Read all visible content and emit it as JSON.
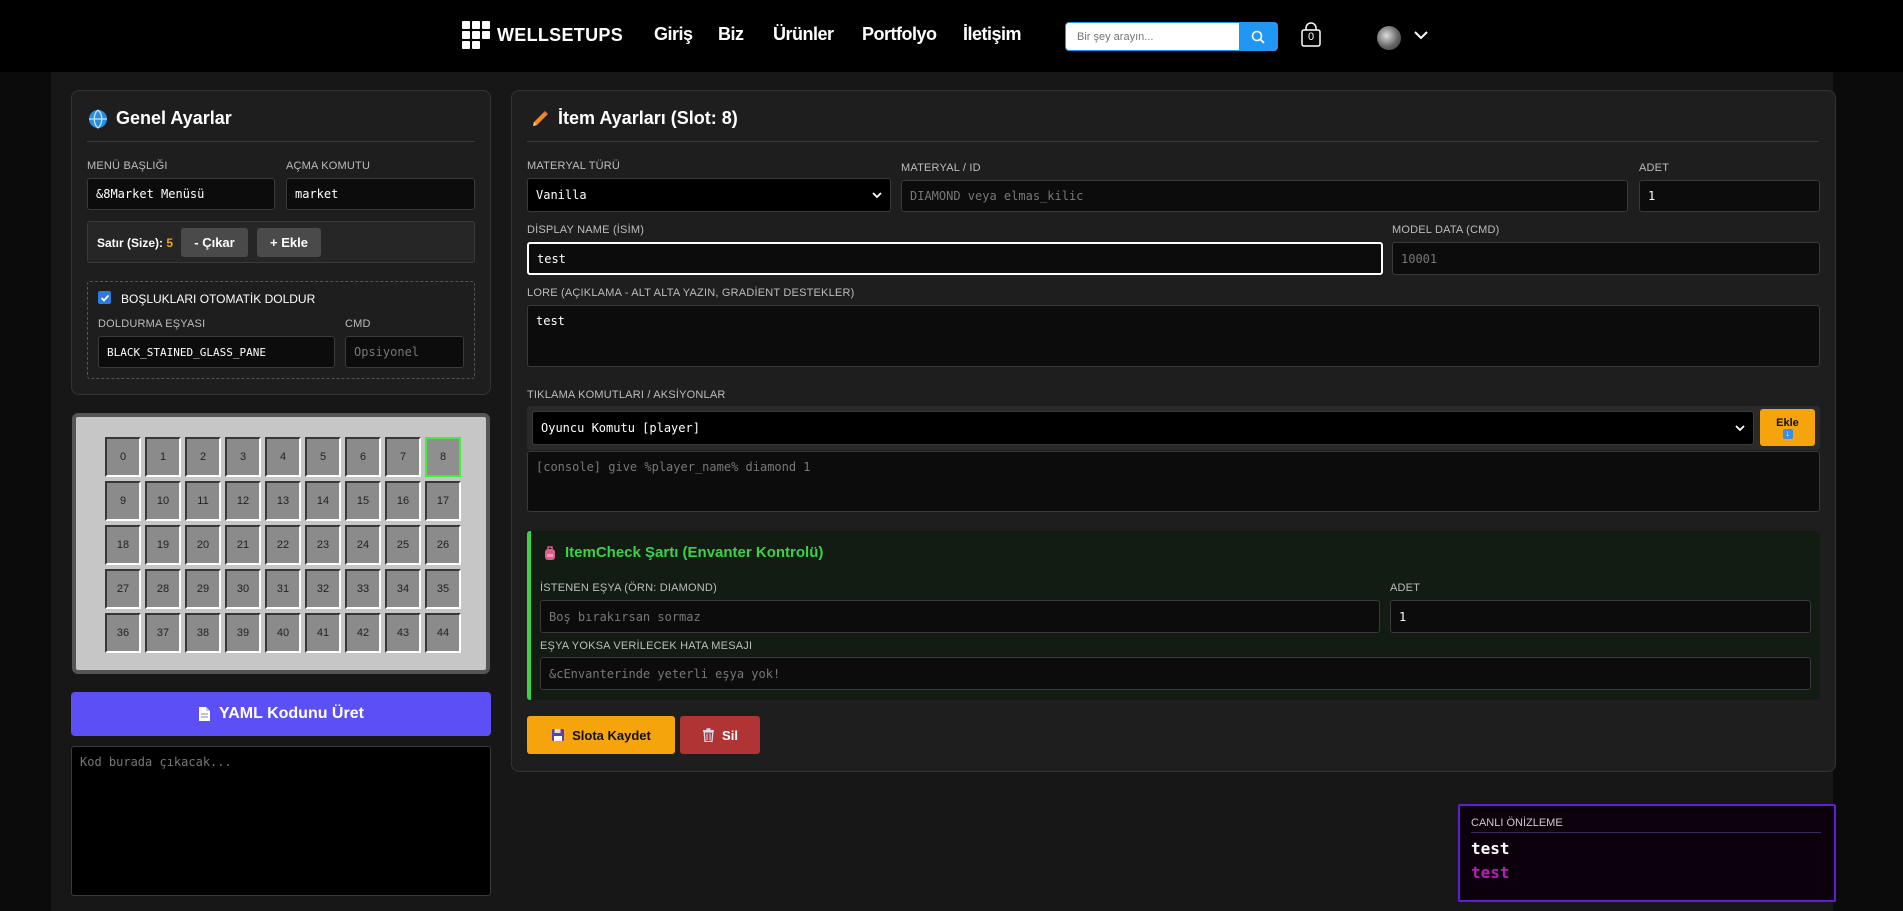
{
  "navbar": {
    "brand": "WELLSETUPS",
    "links": [
      "Giriş",
      "Biz",
      "Ürünler",
      "Portfolyo",
      "İletişim"
    ],
    "search_placeholder": "Bir şey arayın...",
    "cart_count": "0"
  },
  "general": {
    "title": "Genel Ayarlar",
    "menu_title_label": "MENÜ BAŞLIĞI",
    "menu_title_value": "&8Market Menüsü",
    "open_cmd_label": "AÇMA KOMUTU",
    "open_cmd_value": "market",
    "row_label": "Satır (Size):",
    "row_value": "5",
    "remove_btn": "- Çıkar",
    "add_btn": "+ Ekle",
    "autofill_label": "BOŞLUKLARI OTOMATİK DOLDUR",
    "autofill_checked": true,
    "fill_item_label": "DOLDURMA EŞYASI",
    "fill_item_value": "BLACK_STAINED_GLASS_PANE",
    "cmd_label": "CMD",
    "cmd_placeholder": "Opsiyonel"
  },
  "inventory": {
    "slots": [
      "0",
      "1",
      "2",
      "3",
      "4",
      "5",
      "6",
      "7",
      "8",
      "9",
      "10",
      "11",
      "12",
      "13",
      "14",
      "15",
      "16",
      "17",
      "18",
      "19",
      "20",
      "21",
      "22",
      "23",
      "24",
      "25",
      "26",
      "27",
      "28",
      "29",
      "30",
      "31",
      "32",
      "33",
      "34",
      "35",
      "36",
      "37",
      "38",
      "39",
      "40",
      "41",
      "42",
      "43",
      "44"
    ],
    "selected": 8
  },
  "yaml": {
    "button": "YAML Kodunu Üret",
    "placeholder": "Kod burada çıkacak..."
  },
  "item": {
    "title": "İtem Ayarları (Slot: 8)",
    "material_type_label": "MATERYAL TÜRÜ",
    "material_type_value": "Vanilla",
    "material_id_label": "MATERYAL / ID",
    "material_id_placeholder": "DIAMOND veya elmas_kilic",
    "amount_label": "ADET",
    "amount_value": "1",
    "display_name_label": "DİSPLAY NAME (İSİM)",
    "display_name_value": "test",
    "model_data_label": "MODEL DATA (CMD)",
    "model_data_placeholder": "10001",
    "lore_label": "LORE (AÇIKLAMA - ALT ALTA YAZIN, GRADİENT DESTEKLER)",
    "lore_value": "test",
    "actions_label": "TIKLAMA KOMUTLARI / AKSİYONLAR",
    "action_type_value": "Oyuncu Komutu [player]",
    "action_add_btn": "Ekle",
    "actions_placeholder": "[console] give %player_name% diamond 1",
    "itemcheck_title": "ItemCheck Şartı (Envanter Kontrolü)",
    "required_item_label": "İSTENEN EŞYA (ÖRN: DIAMOND)",
    "required_item_placeholder": "Boş bırakırsan sormaz",
    "required_amount_label": "ADET",
    "required_amount_value": "1",
    "error_msg_label": "EŞYA YOKSA VERİLECEK HATA MESAJI",
    "error_msg_placeholder": "&cEnvanterinde yeterli eşya yok!",
    "save_btn": "Slota Kaydet",
    "delete_btn": "Sil"
  },
  "preview": {
    "label": "CANLI ÖNİZLEME",
    "name": "test",
    "lore": "test"
  },
  "colors": {
    "accent_purple": "#5b4ff5",
    "accent_yellow": "#f5a50b",
    "danger": "#b03434",
    "itemcheck_green": "#3bd14a"
  }
}
